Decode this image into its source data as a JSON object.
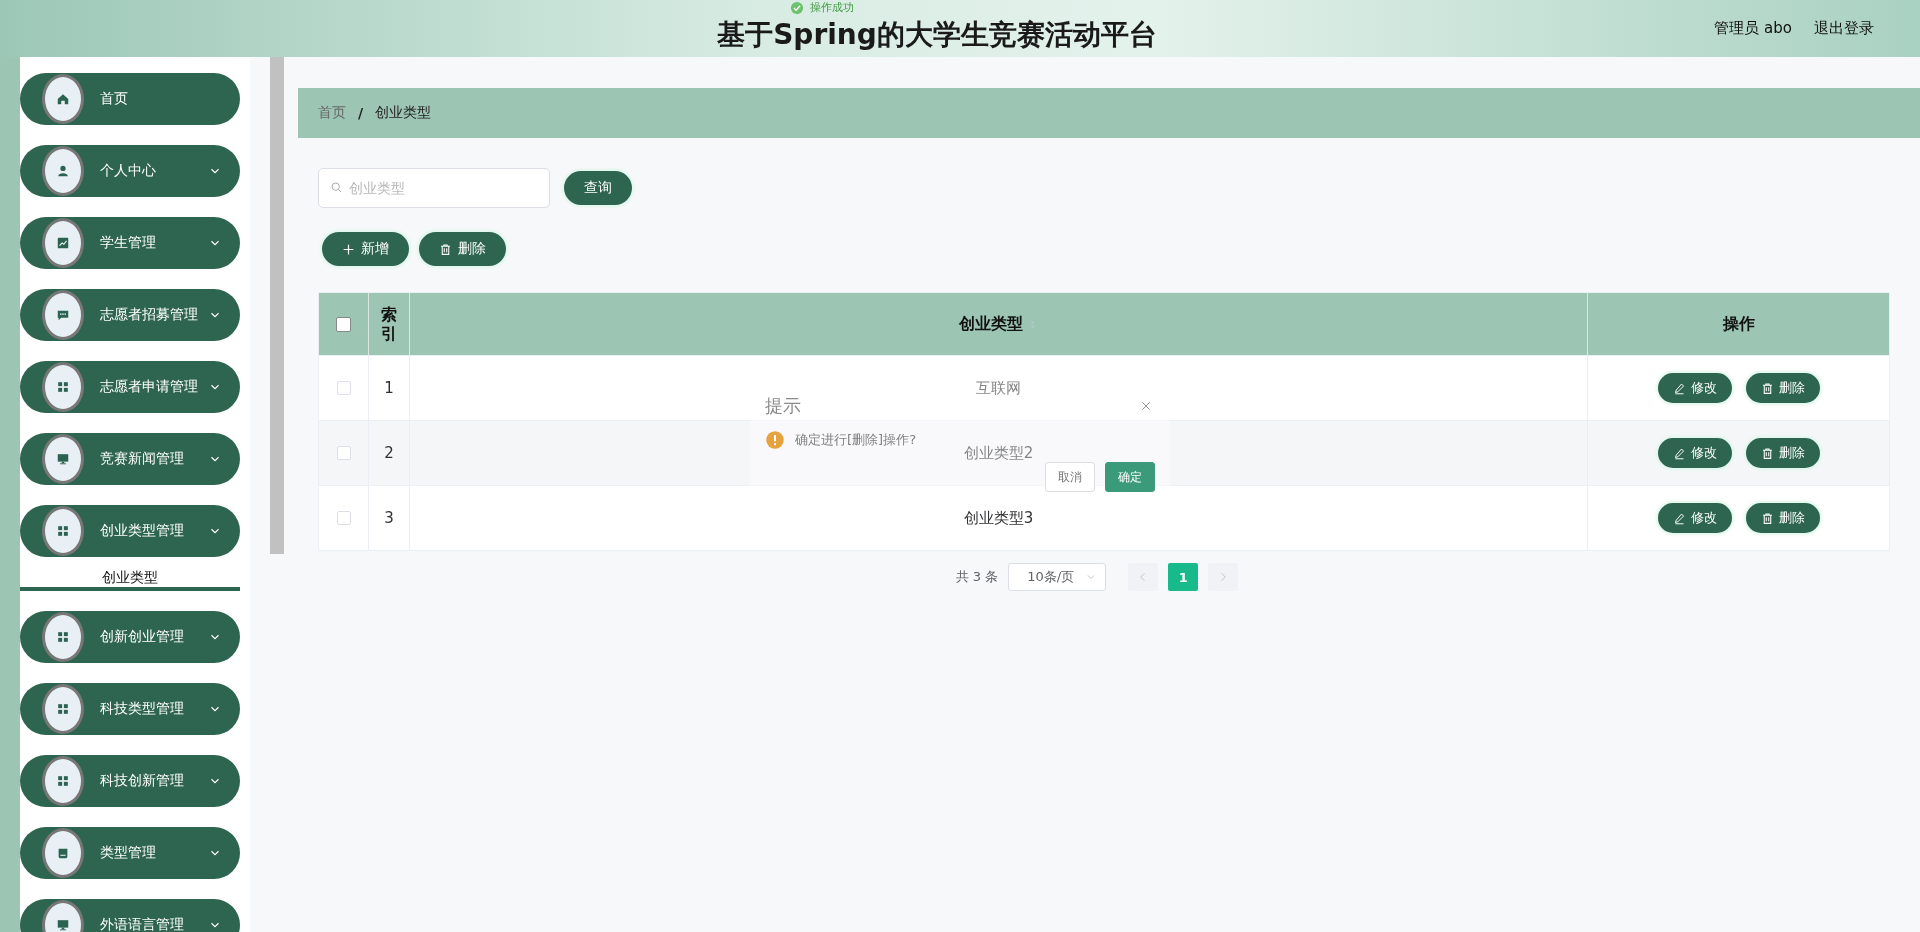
{
  "header": {
    "title": "基于Spring的大学生竞赛活动平台",
    "user": "管理员 abo",
    "logout": "退出登录",
    "toast": "操作成功"
  },
  "sidebar": {
    "items": [
      {
        "label": "首页",
        "has_submenu": false
      },
      {
        "label": "个人中心",
        "has_submenu": true
      },
      {
        "label": "学生管理",
        "has_submenu": true
      },
      {
        "label": "志愿者招募管理",
        "has_submenu": true
      },
      {
        "label": "志愿者申请管理",
        "has_submenu": true
      },
      {
        "label": "竞赛新闻管理",
        "has_submenu": true
      },
      {
        "label": "创业类型管理",
        "has_submenu": true,
        "children": [
          {
            "label": "创业类型",
            "selected": true
          }
        ]
      },
      {
        "label": "创新创业管理",
        "has_submenu": true
      },
      {
        "label": "科技类型管理",
        "has_submenu": true
      },
      {
        "label": "科技创新管理",
        "has_submenu": true
      },
      {
        "label": "类型管理",
        "has_submenu": true
      },
      {
        "label": "外语语言管理",
        "has_submenu": true
      }
    ]
  },
  "breadcrumb": {
    "items": [
      "首页",
      "创业类型"
    ],
    "separator": "/"
  },
  "search": {
    "placeholder": "创业类型",
    "button": "查询"
  },
  "actions": [
    "新增",
    "删除"
  ],
  "table": {
    "columns": [
      "索引",
      "创业类型",
      "操作"
    ],
    "all_checked": false,
    "rows": [
      {
        "index": "1",
        "name": "互联网",
        "checked": false,
        "edit": "修改",
        "delete": "删除"
      },
      {
        "index": "2",
        "name": "创业类型2",
        "checked": false,
        "edit": "修改",
        "delete": "删除"
      },
      {
        "index": "3",
        "name": "创业类型3",
        "checked": false,
        "edit": "修改",
        "delete": "删除"
      }
    ]
  },
  "pagination": {
    "total": "共 3 条",
    "page_size": "10条/页",
    "pages": [
      {
        "label": "1",
        "selected": true
      }
    ]
  },
  "dialog": {
    "title": "提示",
    "message": "确定进行[删除]操作?",
    "cancel": "取消",
    "confirm": "确定"
  }
}
